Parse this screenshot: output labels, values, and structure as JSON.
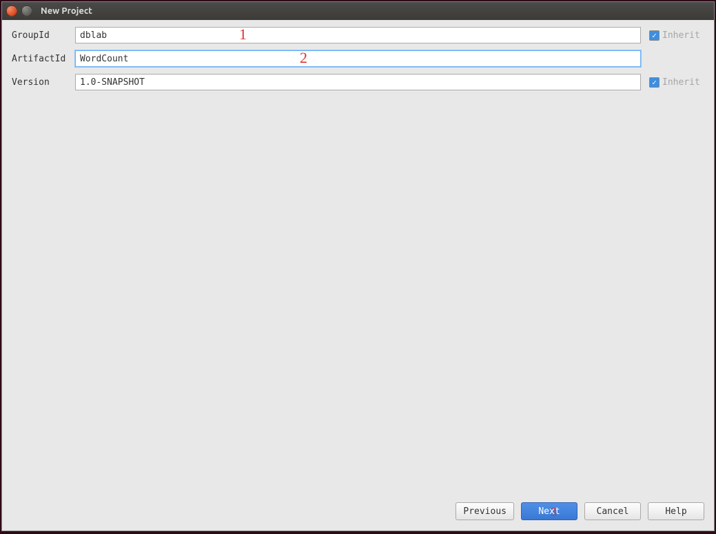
{
  "window": {
    "title": "New Project"
  },
  "form": {
    "groupId": {
      "label": "GroupId",
      "value": "dblab",
      "inherit": "Inherit"
    },
    "artifactId": {
      "label": "ArtifactId",
      "value": "WordCount"
    },
    "version": {
      "label": "Version",
      "value": "1.0-SNAPSHOT",
      "inherit": "Inherit"
    }
  },
  "annotations": {
    "one": "1",
    "two": "2",
    "three": "3"
  },
  "buttons": {
    "previous": "Previous",
    "next": "Next",
    "cancel": "Cancel",
    "help": "Help"
  }
}
